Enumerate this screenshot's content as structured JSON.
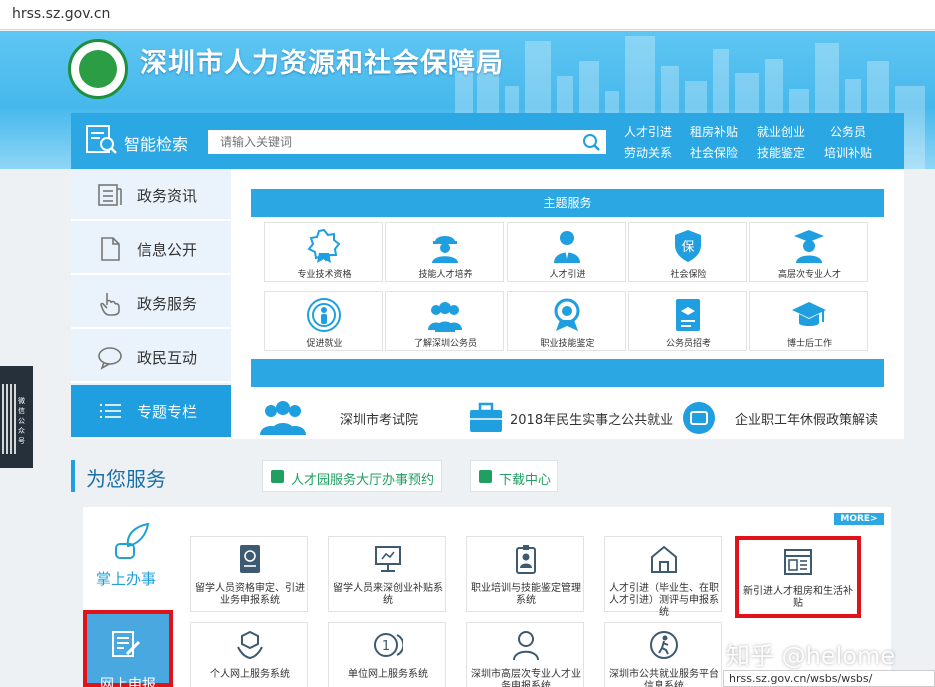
{
  "browser": {
    "url": "hrss.sz.gov.cn",
    "status_url": "hrss.sz.gov.cn/wsbs/wsbs/"
  },
  "header": {
    "title": "深圳市人力资源和社会保障局"
  },
  "search": {
    "title": "智能检索",
    "placeholder": "请输入关键词",
    "quick_links": [
      "人才引进",
      "租房补贴",
      "就业创业",
      "公务员",
      "劳动关系",
      "社会保险",
      "技能鉴定",
      "培训补贴"
    ]
  },
  "sidebar": {
    "items": [
      {
        "label": "政务资讯",
        "icon": "news-icon"
      },
      {
        "label": "信息公开",
        "icon": "document-icon"
      },
      {
        "label": "政务服务",
        "icon": "hand-pointer-icon"
      },
      {
        "label": "政民互动",
        "icon": "chat-bubble-icon"
      },
      {
        "label": "专题专栏",
        "icon": "list-icon",
        "active": true
      }
    ]
  },
  "theme_services": {
    "title": "主题服务",
    "items": [
      {
        "label": "专业技术资格",
        "icon": "certificate-icon"
      },
      {
        "label": "技能人才培养",
        "icon": "worker-icon"
      },
      {
        "label": "人才引进",
        "icon": "person-icon"
      },
      {
        "label": "社会保险",
        "icon": "shield-icon"
      },
      {
        "label": "高层次专业人才",
        "icon": "graduate-icon"
      },
      {
        "label": "促进就业",
        "icon": "signal-person-icon"
      },
      {
        "label": "了解深圳公务员",
        "icon": "group-icon"
      },
      {
        "label": "职业技能鉴定",
        "icon": "medal-icon"
      },
      {
        "label": "公务员招考",
        "icon": "exam-icon"
      },
      {
        "label": "博士后工作",
        "icon": "mortarboard-icon"
      }
    ]
  },
  "notices": [
    "深圳市考试院",
    "2018年民生实事之公共就业",
    "企业职工年休假政策解读"
  ],
  "services": {
    "title": "为您服务",
    "pills": [
      "人才园服务大厅办事预约",
      "下载中心"
    ],
    "more": "MORE>",
    "mobile_label": "掌上办事",
    "online_label": "网上申报",
    "items": [
      {
        "label": "留学人员资格审定、引进业务申报系统",
        "icon": "passport-icon"
      },
      {
        "label": "留学人员来深创业补贴系统",
        "icon": "computer-icon"
      },
      {
        "label": "职业培训与技能鉴定管理系统",
        "icon": "badge-icon"
      },
      {
        "label": "人才引进（毕业生、在职人才引进）测评与申报系统",
        "icon": "house-icon"
      },
      {
        "label": "新引进人才租房和生活补贴",
        "icon": "webpage-icon"
      },
      {
        "label": "个人网上服务系统",
        "icon": "hands-box-icon"
      },
      {
        "label": "单位网上服务系统",
        "icon": "coin-icon"
      },
      {
        "label": "深圳市高层次专业人才业务申报系统",
        "icon": "person-outline-icon"
      },
      {
        "label": "深圳市公共就业服务平台信息系统",
        "icon": "walking-icon"
      }
    ]
  },
  "qr": {
    "caption": "微信公众号"
  },
  "watermark": "知乎 @helome"
}
